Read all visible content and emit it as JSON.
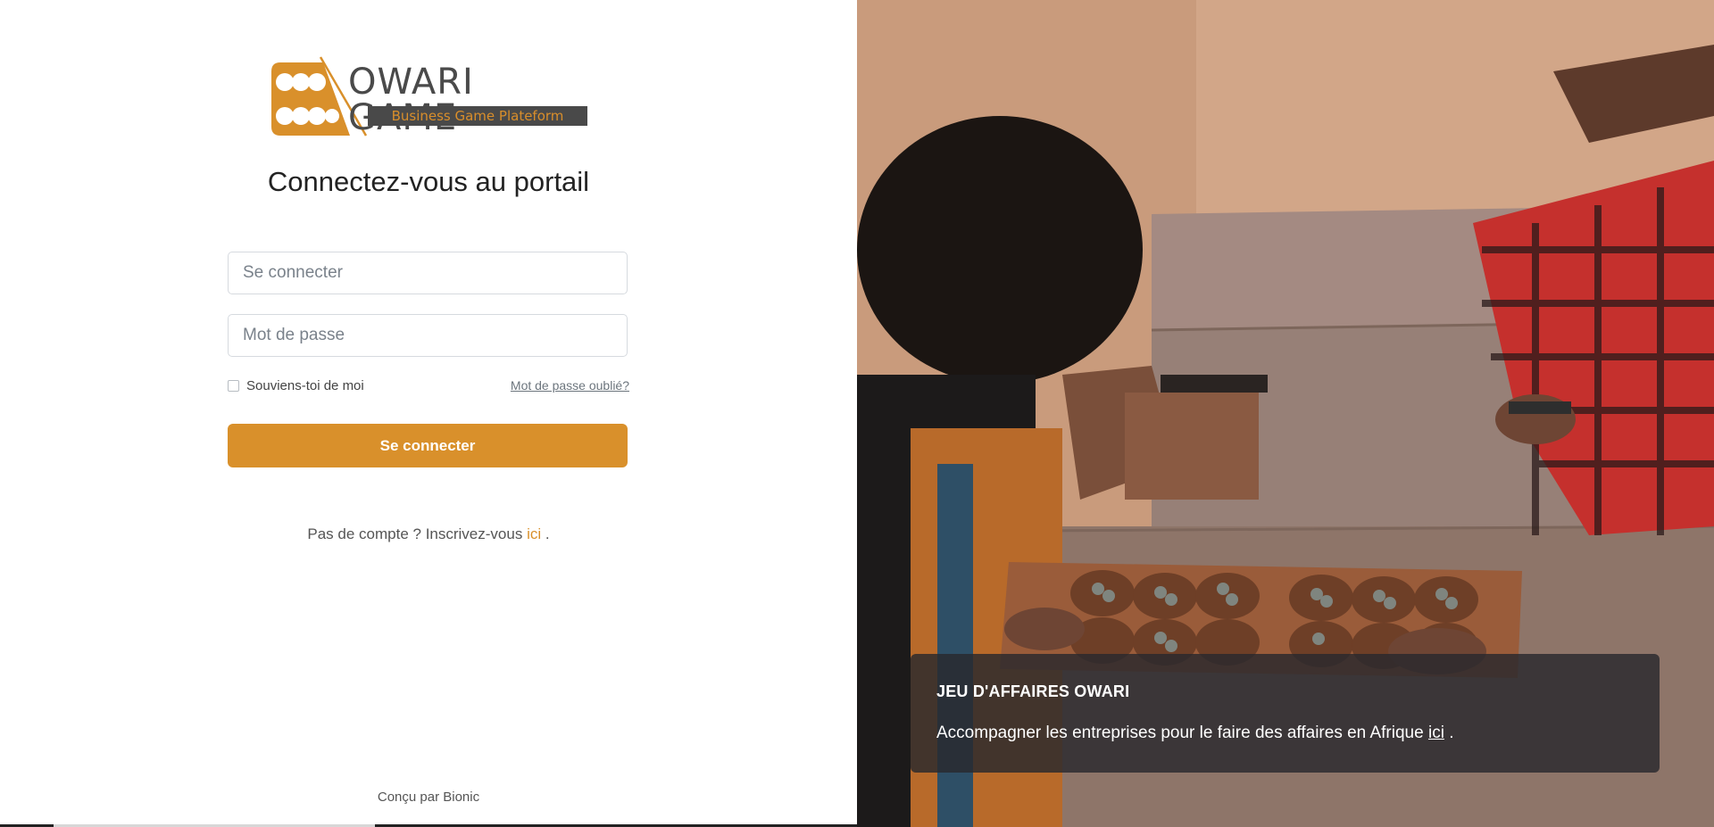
{
  "logo": {
    "title": "OWARI GAME",
    "subtitle": "Business Game Plateform",
    "colors": {
      "brand": "#d9902b",
      "dark": "#494949"
    }
  },
  "login": {
    "heading": "Connectez-vous au portail",
    "username_placeholder": "Se connecter",
    "password_placeholder": "Mot de passe",
    "remember_label": "Souviens-toi de moi",
    "forgot_label": "Mot de passe oublié?",
    "submit_label": "Se connecter",
    "signup_prefix": "Pas de compte ? Inscrivez-vous",
    "signup_link": "ici",
    "signup_suffix": "."
  },
  "footer": {
    "credit": "Conçu par Bionic"
  },
  "hero": {
    "title": "JEU D'AFFAIRES OWARI",
    "text": "Accompagner les entreprises pour le faire des affaires en Afrique",
    "link": "ici",
    "suffix": "."
  },
  "colors": {
    "accent": "#d9902b",
    "card_bg": "#28282d"
  }
}
